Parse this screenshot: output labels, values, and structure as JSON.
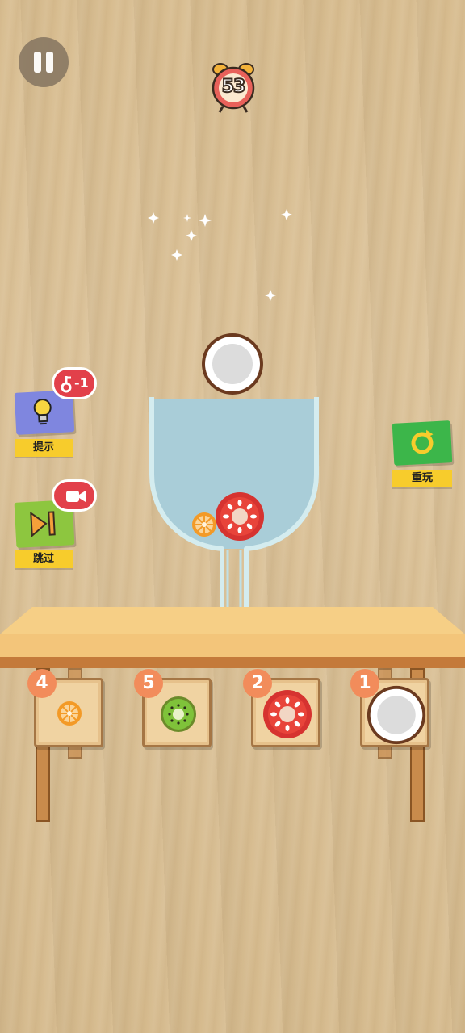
{
  "timer": {
    "seconds": "53"
  },
  "buttons": {
    "hint_label": "提示",
    "hint_cost": "-1",
    "skip_label": "跳过",
    "replay_label": "重玩"
  },
  "trays": [
    {
      "fruit": "orange-slice",
      "count": "4"
    },
    {
      "fruit": "kiwi-slice",
      "count": "5"
    },
    {
      "fruit": "tomato-slice",
      "count": "2"
    },
    {
      "fruit": "coconut-half",
      "count": "1"
    }
  ],
  "colors": {
    "water": "#a9cdd8",
    "table": "#f3c57a",
    "badge": "#f28c5b",
    "label": "#f7cc2c"
  }
}
